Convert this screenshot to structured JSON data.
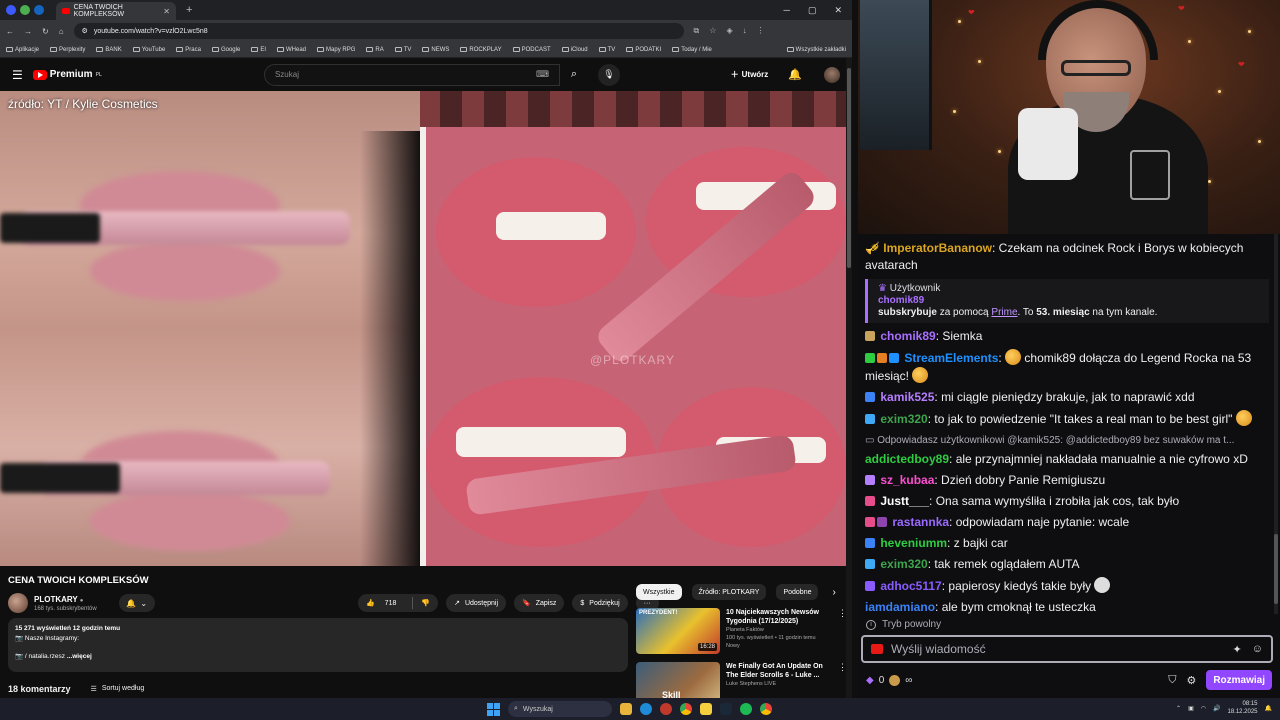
{
  "browser": {
    "tab_title": "CENA TWOICH KOMPLEKSÓW",
    "url": "youtube.com/watch?v=vzlO2Lwc5n8",
    "bookmarks": [
      "Aplikacje",
      "Perplexity",
      "BANK",
      "YouTube",
      "Praca",
      "Google",
      "EI",
      "WHead",
      "Mapy RPG",
      "RA",
      "TV",
      "NEWS",
      "ROCKPLAY",
      "PODCAST",
      "iCloud",
      "TV",
      "PODATKI",
      "Today / Mie"
    ],
    "all_bookmarks": "Wszystkie zakładki"
  },
  "youtube": {
    "logo": "Premium",
    "logo_region": "PL",
    "search_placeholder": "Szukaj",
    "create_label": "Utwórz",
    "video": {
      "source_text": "źródło: YT / Kylie Cosmetics",
      "watermark": "@PLOTKARY",
      "title": "CENA TWOICH KOMPLEKSÓW",
      "channel": "PLOTKARY",
      "subscribers": "168 tys. subskrybentów",
      "likes": "718",
      "share_label": "Udostępnij",
      "save_label": "Zapisz",
      "thanks_label": "Podziękuj",
      "more_label": "···",
      "views_line": "15 271 wyświetleń  12 godzin temu",
      "desc_line1": "📷 Nasze Instagramy:",
      "desc_line2": "📷 / natalia.rzesz",
      "desc_more": "...więcej",
      "comments_count": "18 komentarzy",
      "sort_label": "Sortuj według"
    },
    "chips": [
      "Wszystkie",
      "Źródło: PLOTKARY",
      "Podobne"
    ],
    "recommended": [
      {
        "title": "10 Najciekawszych Newsów Tygodnia (17/12/2025)",
        "channel": "Planeta Faktów",
        "meta": "100 tys. wyświetleń • 11 godzin temu",
        "badge": "Nowy",
        "duration": "16:28",
        "thumb_text": "PREZYDENT!"
      },
      {
        "title": "We Finally Got An Update On The Elder Scrolls 6 - Luke ...",
        "channel": "Luke Stephens LIVE",
        "meta": "",
        "badge": "",
        "duration": "",
        "thumb_text": "Skill"
      }
    ]
  },
  "chat": {
    "messages": [
      {
        "user": "ImperatorBananow",
        "color": "#daa520",
        "text": "Czekam na odcinek Rock i Borys w kobiecych avatarach"
      }
    ],
    "subscription": {
      "label": "Użytkownik",
      "user": "chomik89",
      "line_pre": "subskrybuje",
      "line_mid": " za pomocą ",
      "link": "Prime",
      "line_post": ". To ",
      "months": "53. miesiąc",
      "line_end": " na tym kanale."
    },
    "after": [
      {
        "user": "chomik89",
        "color": "#a970ff",
        "text": "Siemka"
      },
      {
        "user": "StreamElements",
        "color": "#1e90ff",
        "text": "chomik89 dołącza do Legend Rocka na 53 miesiąc!"
      },
      {
        "user": "kamik525",
        "color": "#b57eff",
        "text": "mi ciągle pieniędzy brakuje, jak to naprawić xdd"
      },
      {
        "user": "exim320",
        "color": "#3fa34d",
        "text": "to jak to powiedzenie \"It takes a real man to be best girl\""
      }
    ],
    "reply_text": "Odpowiadasz użytkownikowi @kamik525: @addictedboy89 bez suwaków ma t...",
    "after2": [
      {
        "user": "addictedboy89",
        "color": "#2ecc40",
        "text": "ale przynajmniej nakładała manualnie a nie cyfrowo xD"
      },
      {
        "user": "sz_kubaa",
        "color": "#ff4dd2",
        "text": "Dzień dobry Panie Remigiuszu"
      },
      {
        "user": "Justt___",
        "color": "#ffffff",
        "text": "Ona sama wymyśliła i zrobiła jak cos, tak było"
      },
      {
        "user": "rastannka",
        "color": "#9b6bff",
        "text": "odpowiadam naje pytanie: wcale"
      },
      {
        "user": "heveniumm",
        "color": "#2ecc40",
        "text": "z bajki car"
      },
      {
        "user": "exim320",
        "color": "#3fa34d",
        "text": "tak remek oglądałem AUTA"
      },
      {
        "user": "adhoc5117",
        "color": "#8a5cff",
        "text": "papierosy kiedyś takie były"
      },
      {
        "user": "iamdamiano",
        "color": "#3b82f6",
        "text": "ale bym cmoknął te usteczka"
      }
    ],
    "slow_mode": "Tryb powolny",
    "input_placeholder": "Wyślij wiadomość",
    "points": "0",
    "points_extra": "∞",
    "send_label": "Rozmawiaj"
  },
  "taskbar": {
    "search": "Wyszukaj",
    "time": "08:15",
    "date": "18.12.2025"
  }
}
